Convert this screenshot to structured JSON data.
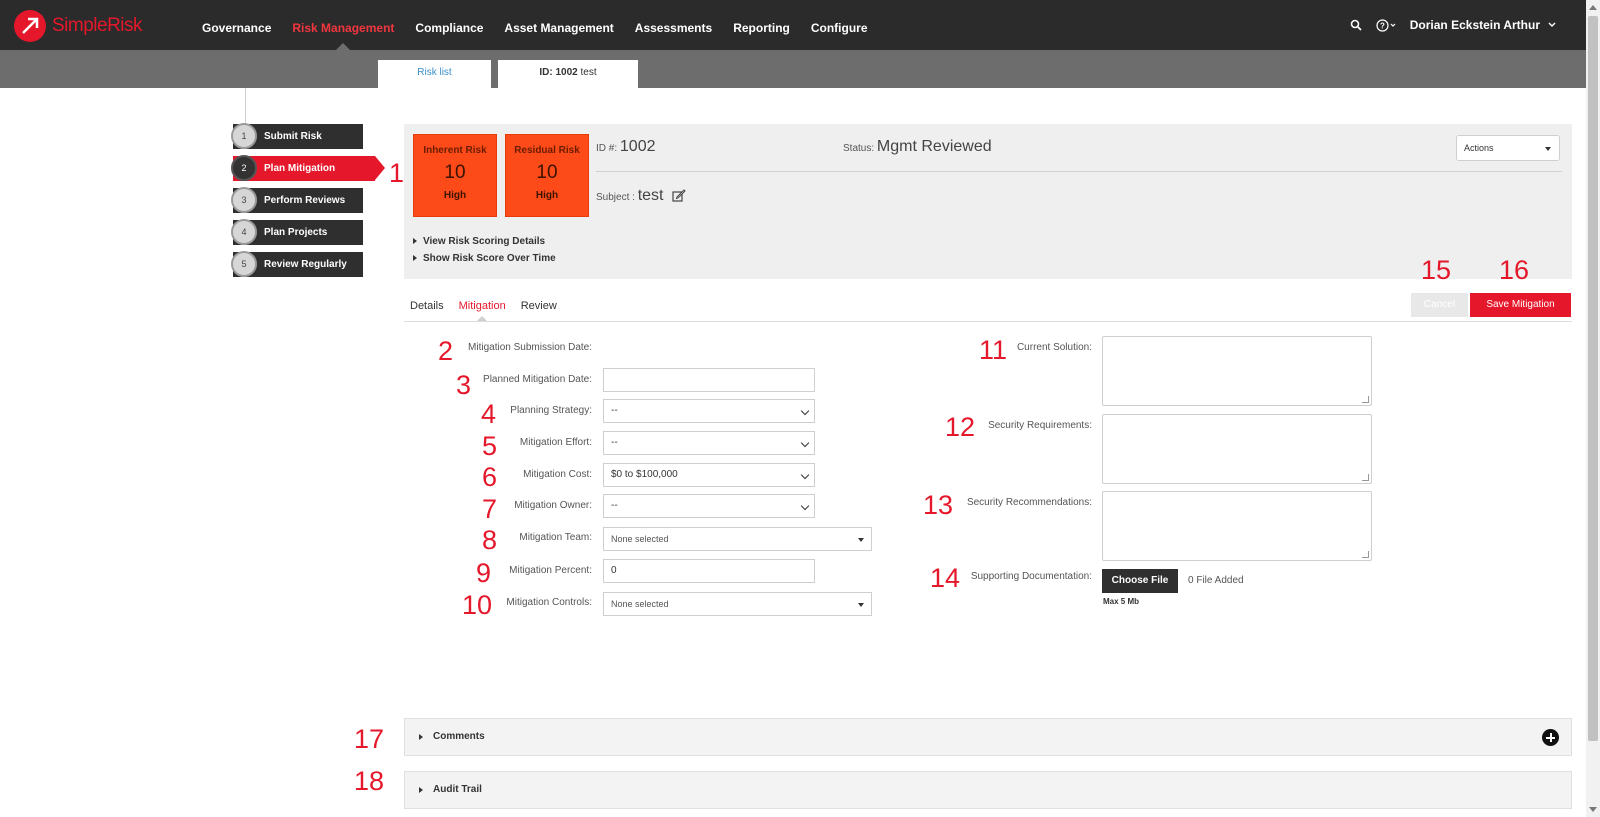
{
  "app": {
    "logo_text": "SimpleRisk"
  },
  "nav": {
    "items": [
      {
        "label": "Governance"
      },
      {
        "label": "Risk Management"
      },
      {
        "label": "Compliance"
      },
      {
        "label": "Asset Management"
      },
      {
        "label": "Assessments"
      },
      {
        "label": "Reporting"
      },
      {
        "label": "Configure"
      }
    ],
    "active": "Risk Management",
    "user_name": "Dorian Eckstein Arthur"
  },
  "subtabs": {
    "risk_list": "Risk list",
    "id_label": "ID: 1002",
    "id_name": "test"
  },
  "steps": [
    {
      "num": "1",
      "label": "Submit Risk"
    },
    {
      "num": "2",
      "label": "Plan Mitigation"
    },
    {
      "num": "3",
      "label": "Perform Reviews"
    },
    {
      "num": "4",
      "label": "Plan Projects"
    },
    {
      "num": "5",
      "label": "Review Regularly"
    }
  ],
  "risk": {
    "inherent_label": "Inherent Risk",
    "inherent_value": "10",
    "inherent_level": "High",
    "residual_label": "Residual Risk",
    "residual_value": "10",
    "residual_level": "High",
    "id_prefix": "ID #:",
    "id": "1002",
    "status_prefix": "Status:",
    "status": "Mgmt Reviewed",
    "subject_prefix": "Subject :",
    "subject": "test",
    "actions_label": "Actions",
    "view_scoring": "View Risk Scoring Details",
    "show_score_time": "Show Risk Score Over Time",
    "color": "#fc4b19"
  },
  "tabs": [
    {
      "label": "Details"
    },
    {
      "label": "Mitigation"
    },
    {
      "label": "Review"
    }
  ],
  "buttons": {
    "cancel": "Cancel",
    "save": "Save Mitigation"
  },
  "form": {
    "submission_date_label": "Mitigation Submission Date:",
    "planned_date_label": "Planned Mitigation Date:",
    "planned_date_value": "",
    "strategy_label": "Planning Strategy:",
    "strategy_value": "--",
    "effort_label": "Mitigation Effort:",
    "effort_value": "--",
    "cost_label": "Mitigation Cost:",
    "cost_value": "$0 to $100,000",
    "owner_label": "Mitigation Owner:",
    "owner_value": "--",
    "team_label": "Mitigation Team:",
    "team_value": "None selected",
    "percent_label": "Mitigation Percent:",
    "percent_value": "0",
    "controls_label": "Mitigation Controls:",
    "controls_value": "None selected",
    "current_solution_label": "Current Solution:",
    "security_requirements_label": "Security Requirements:",
    "security_recommendations_label": "Security Recommendations:",
    "supporting_docs_label": "Supporting Documentation:",
    "choose_file": "Choose File",
    "file_added": "0 File Added",
    "max_size": "Max 5 Mb"
  },
  "accordions": {
    "comments": "Comments",
    "audit": "Audit Trail"
  },
  "annotations": [
    "1",
    "2",
    "3",
    "4",
    "5",
    "6",
    "7",
    "8",
    "9",
    "10",
    "11",
    "12",
    "13",
    "14",
    "15",
    "16",
    "17",
    "18"
  ],
  "colors": {
    "accent": "#e5172b",
    "topbar": "#2b2b2b",
    "subbar": "#6d6d6d"
  }
}
